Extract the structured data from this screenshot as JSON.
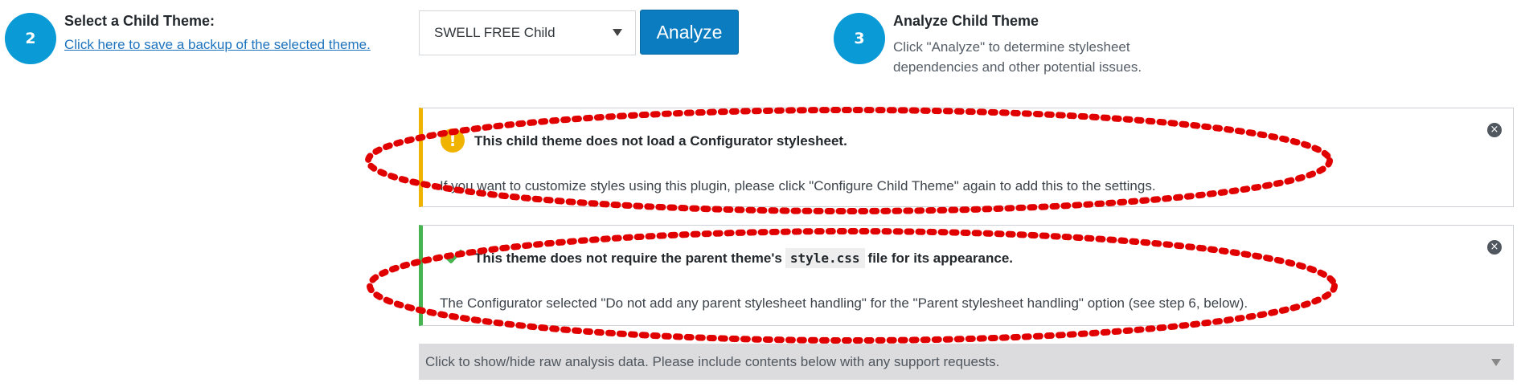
{
  "step2": {
    "number": "2",
    "title": "Select a Child Theme:",
    "backup_link": "Click here to save a backup of the selected theme."
  },
  "theme_select": {
    "value": "SWELL FREE Child"
  },
  "analyze_button": {
    "label": "Analyze"
  },
  "step3": {
    "number": "3",
    "title": "Analyze Child Theme",
    "description": "Click \"Analyze\" to determine stylesheet dependencies and other potential issues."
  },
  "notices": {
    "warning": {
      "icon": "exclamation-icon",
      "title": "This child theme does not load a Configurator stylesheet.",
      "body": "If you want to customize styles using this plugin, please click \"Configure Child Theme\" again to add this to the settings."
    },
    "success": {
      "icon": "checkmark-icon",
      "title_before": "This theme does not require the parent theme's",
      "title_code": "style.css",
      "title_after": "file for its appearance.",
      "body": "The Configurator selected \"Do not add any parent stylesheet handling\" for the \"Parent stylesheet handling\" option (see step 6, below)."
    }
  },
  "raw_data_toggle": {
    "label": "Click to show/hide raw analysis data. Please include contents below with any support requests."
  },
  "colors": {
    "step_circle": "#0a9ad6",
    "analyze_button": "#0c7cc0",
    "warning_border": "#f0b400",
    "success_border": "#46b450",
    "annotation": "#e00000"
  }
}
